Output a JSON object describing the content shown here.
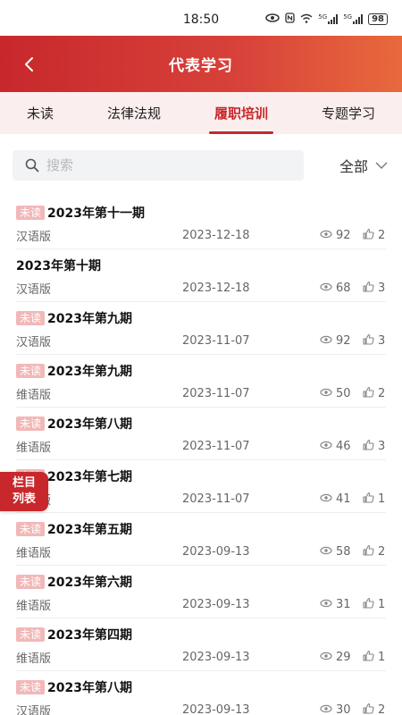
{
  "status_bar": {
    "time": "18:50",
    "battery": "98",
    "network_1": "5G",
    "network_2": "5G"
  },
  "header": {
    "title": "代表学习"
  },
  "tabs": [
    {
      "label": "未读"
    },
    {
      "label": "法律法规"
    },
    {
      "label": "履职培训"
    },
    {
      "label": "专题学习"
    }
  ],
  "active_tab_index": 2,
  "search": {
    "placeholder": "搜索",
    "filter_label": "全部"
  },
  "floating_button": {
    "line1": "栏目",
    "line2": "列表"
  },
  "items": [
    {
      "badge": "未读",
      "title": "2023年第十一期",
      "lang": "汉语版",
      "date": "2023-12-18",
      "views": "92",
      "likes": "2"
    },
    {
      "badge": "",
      "title": "2023年第十期",
      "lang": "汉语版",
      "date": "2023-12-18",
      "views": "68",
      "likes": "3"
    },
    {
      "badge": "未读",
      "title": "2023年第九期",
      "lang": "汉语版",
      "date": "2023-11-07",
      "views": "92",
      "likes": "3"
    },
    {
      "badge": "未读",
      "title": "2023年第九期",
      "lang": "维语版",
      "date": "2023-11-07",
      "views": "50",
      "likes": "2"
    },
    {
      "badge": "未读",
      "title": "2023年第八期",
      "lang": "维语版",
      "date": "2023-11-07",
      "views": "46",
      "likes": "3"
    },
    {
      "badge": "未读",
      "title": "2023年第七期",
      "lang": "维语版",
      "date": "2023-11-07",
      "views": "41",
      "likes": "1"
    },
    {
      "badge": "未读",
      "title": "2023年第五期",
      "lang": "维语版",
      "date": "2023-09-13",
      "views": "58",
      "likes": "2"
    },
    {
      "badge": "未读",
      "title": "2023年第六期",
      "lang": "维语版",
      "date": "2023-09-13",
      "views": "31",
      "likes": "1"
    },
    {
      "badge": "未读",
      "title": "2023年第四期",
      "lang": "维语版",
      "date": "2023-09-13",
      "views": "29",
      "likes": "1"
    },
    {
      "badge": "未读",
      "title": "2023年第八期",
      "lang": "汉语版",
      "date": "2023-09-13",
      "views": "30",
      "likes": "2"
    }
  ],
  "colors": {
    "accent": "#c8282c",
    "badge": "#f2b8b8",
    "tab_bg": "#fbeeee"
  }
}
